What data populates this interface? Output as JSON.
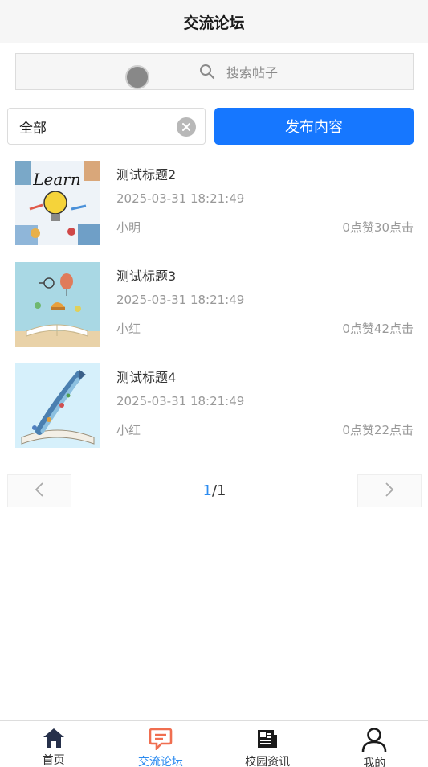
{
  "header": {
    "title": "交流论坛"
  },
  "search": {
    "placeholder": "搜索帖子"
  },
  "filter": {
    "category_value": "全部",
    "publish_label": "发布内容"
  },
  "posts": [
    {
      "title": "测试标题2",
      "time": "2025-03-31 18:21:49",
      "author": "小明",
      "stats": "0点赞30点击",
      "thumb": "learn-lightbulb"
    },
    {
      "title": "测试标题3",
      "time": "2025-03-31 18:21:49",
      "author": "小红",
      "stats": "0点赞42点击",
      "thumb": "open-book-balloon"
    },
    {
      "title": "测试标题4",
      "time": "2025-03-31 18:21:49",
      "author": "小红",
      "stats": "0点赞22点击",
      "thumb": "open-book-rocket"
    }
  ],
  "pager": {
    "current": "1",
    "separator": "/",
    "total": "1"
  },
  "tabbar": {
    "items": [
      {
        "label": "首页",
        "icon": "home-icon"
      },
      {
        "label": "交流论坛",
        "icon": "chat-icon",
        "active": true
      },
      {
        "label": "校园资讯",
        "icon": "news-icon"
      },
      {
        "label": "我的",
        "icon": "user-icon"
      }
    ]
  },
  "colors": {
    "accent": "#1677ff",
    "active_tab": "#2d8cf0",
    "chat_icon": "#f06e50"
  }
}
